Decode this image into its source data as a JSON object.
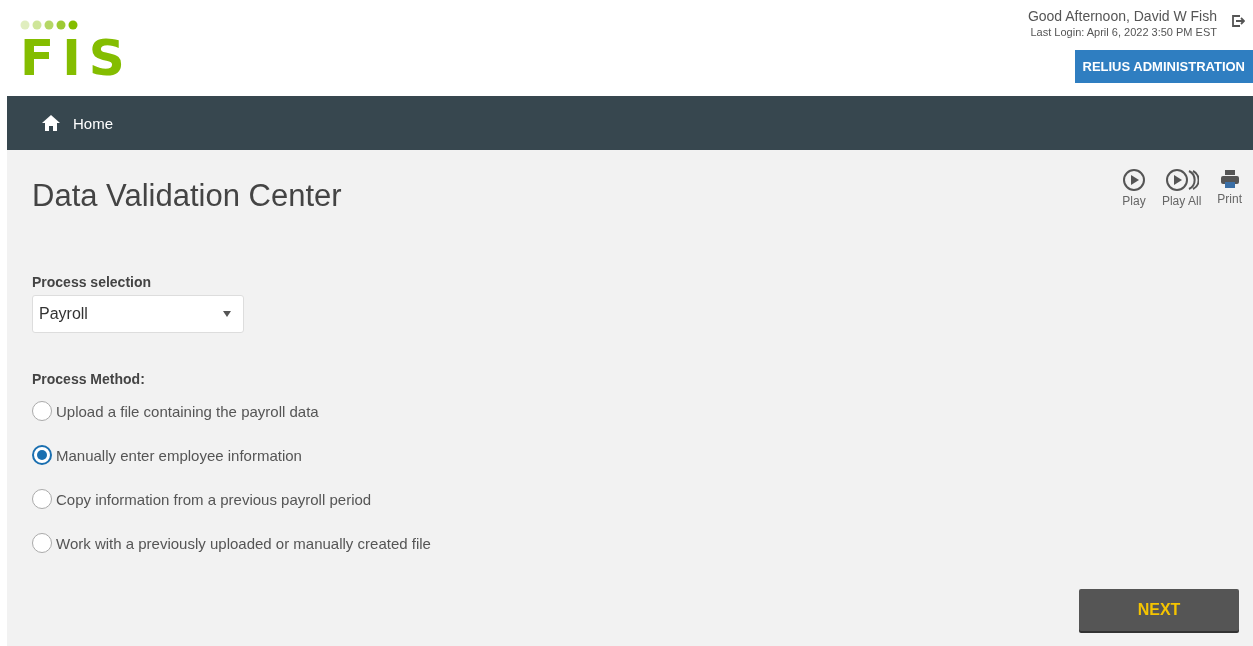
{
  "logo": {
    "text": "FIS"
  },
  "user": {
    "greeting": "Good Afternoon,  David W Fish",
    "last_login": "Last Login: April 6, 2022 3:50 PM EST"
  },
  "admin_button": "RELIUS ADMINISTRATION",
  "nav": {
    "home": "Home"
  },
  "page_title": "Data Validation Center",
  "tools": [
    {
      "kind": "play",
      "label": "Play"
    },
    {
      "kind": "playall",
      "label": "Play All"
    },
    {
      "kind": "print",
      "label": "Print"
    }
  ],
  "process_selection": {
    "label": "Process selection",
    "value": "Payroll"
  },
  "process_method": {
    "label": "Process Method:",
    "options": [
      {
        "label": "Upload a file containing the payroll data",
        "selected": false
      },
      {
        "label": "Manually enter employee information",
        "selected": true
      },
      {
        "label": "Copy information from a previous payroll period",
        "selected": false
      },
      {
        "label": "Work with a previously uploaded or manually created file",
        "selected": false
      }
    ]
  },
  "next_button": "NEXT"
}
